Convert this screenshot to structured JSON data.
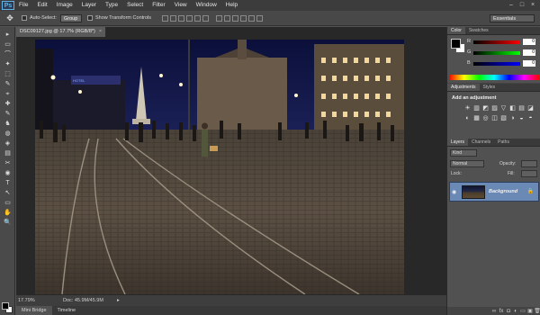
{
  "menu": [
    "File",
    "Edit",
    "Image",
    "Layer",
    "Type",
    "Select",
    "Filter",
    "View",
    "Window",
    "Help"
  ],
  "app_logo": "Ps",
  "options": {
    "auto_select_label": "Auto-Select:",
    "auto_select_value": "Group",
    "show_transform_label": "Show Transform Controls",
    "workspace": "Essentials"
  },
  "document": {
    "tab_title": "DSC09127.jpg @ 17.7% (RGB/8*)",
    "tab_close": "×",
    "zoom": "17.79%",
    "doc_size": "Doc: 45.9M/45.9M",
    "arrow": "▸"
  },
  "bottom_tabs": [
    "Mini Bridge",
    "Timeline"
  ],
  "color_panel": {
    "tabs": [
      "Color",
      "Swatches"
    ],
    "sliders": [
      {
        "label": "R",
        "value": "0",
        "gradient": [
          "#000000",
          "#ff0000"
        ]
      },
      {
        "label": "G",
        "value": "0",
        "gradient": [
          "#000000",
          "#00ff00"
        ]
      },
      {
        "label": "B",
        "value": "0",
        "gradient": [
          "#000000",
          "#0000ff"
        ]
      }
    ]
  },
  "adjustments_panel": {
    "tabs": [
      "Adjustments",
      "Styles"
    ],
    "title": "Add an adjustment",
    "icons": [
      "☀",
      "▥",
      "◩",
      "▨",
      "▽",
      "◧",
      "▤",
      "◪",
      "◐",
      "▦",
      "◎",
      "◫",
      "▧",
      "◑",
      "◒",
      "◓"
    ]
  },
  "layers_panel": {
    "tabs": [
      "Layers",
      "Channels",
      "Paths"
    ],
    "kind_label": "Kind",
    "blend_mode": "Normal",
    "opacity_label": "Opacity:",
    "lock_label": "Lock:",
    "fill_label": "Fill:",
    "layer_name": "Background",
    "footer_icons": [
      "∞",
      "fx",
      "◘",
      "◐",
      "▭",
      "▣",
      "🗑"
    ]
  },
  "tools": [
    "▸",
    "▭",
    "⌒",
    "✦",
    "⬚",
    "✎",
    "⌖",
    "✚",
    "✎",
    "♞",
    "◍",
    "◈",
    "▤",
    "✂",
    "◉",
    "💧",
    "✋",
    "✒",
    "T",
    "↖",
    "▭",
    "✋",
    "🔍"
  ]
}
